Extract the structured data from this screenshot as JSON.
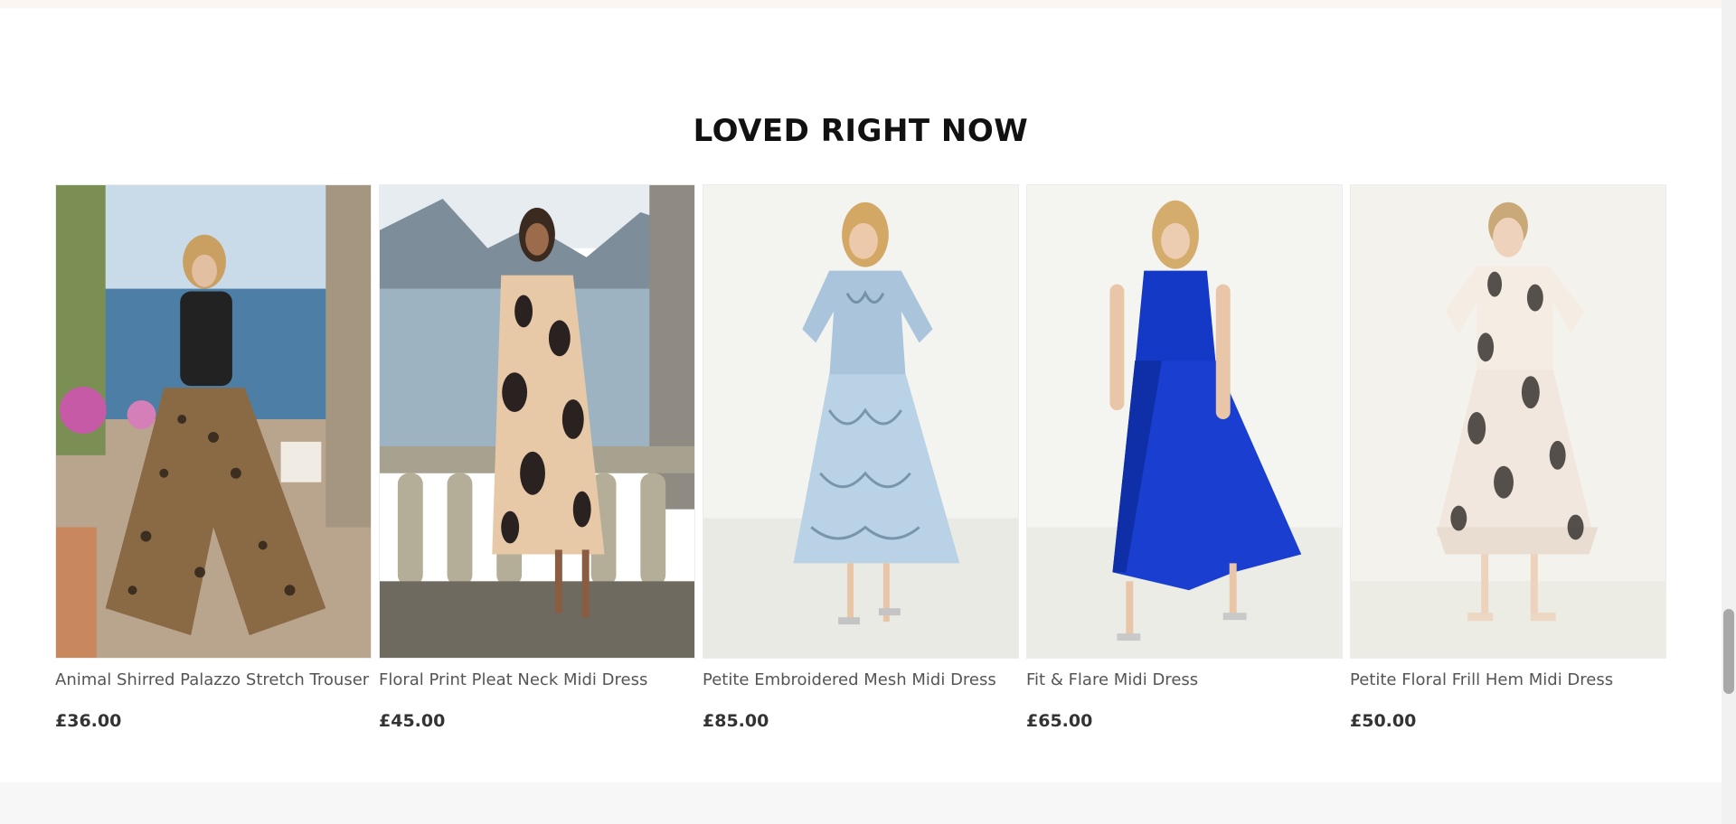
{
  "section": {
    "title": "LOVED RIGHT NOW"
  },
  "products": [
    {
      "name": "Animal Shirred Palazzo Stretch Trouser",
      "price": "£36.00",
      "image_icon": "product-photo-icon"
    },
    {
      "name": "Floral Print Pleat Neck Midi Dress",
      "price": "£45.00",
      "image_icon": "product-photo-icon"
    },
    {
      "name": "Petite Embroidered Mesh Midi Dress",
      "price": "£85.00",
      "image_icon": "product-photo-icon"
    },
    {
      "name": "Fit & Flare Midi Dress",
      "price": "£65.00",
      "image_icon": "product-photo-icon"
    },
    {
      "name": "Petite Floral Frill Hem Midi Dress",
      "price": "£50.00",
      "image_icon": "product-photo-icon"
    }
  ],
  "colors": {
    "top_strip": "#fdf5f0",
    "title": "#111111",
    "product_name": "#555555",
    "price": "#333333",
    "bottom_band": "#f7f7f7",
    "scrollbar_thumb": "#a8a8a8"
  },
  "scrollbar": {
    "scroll_position": 0.74
  }
}
